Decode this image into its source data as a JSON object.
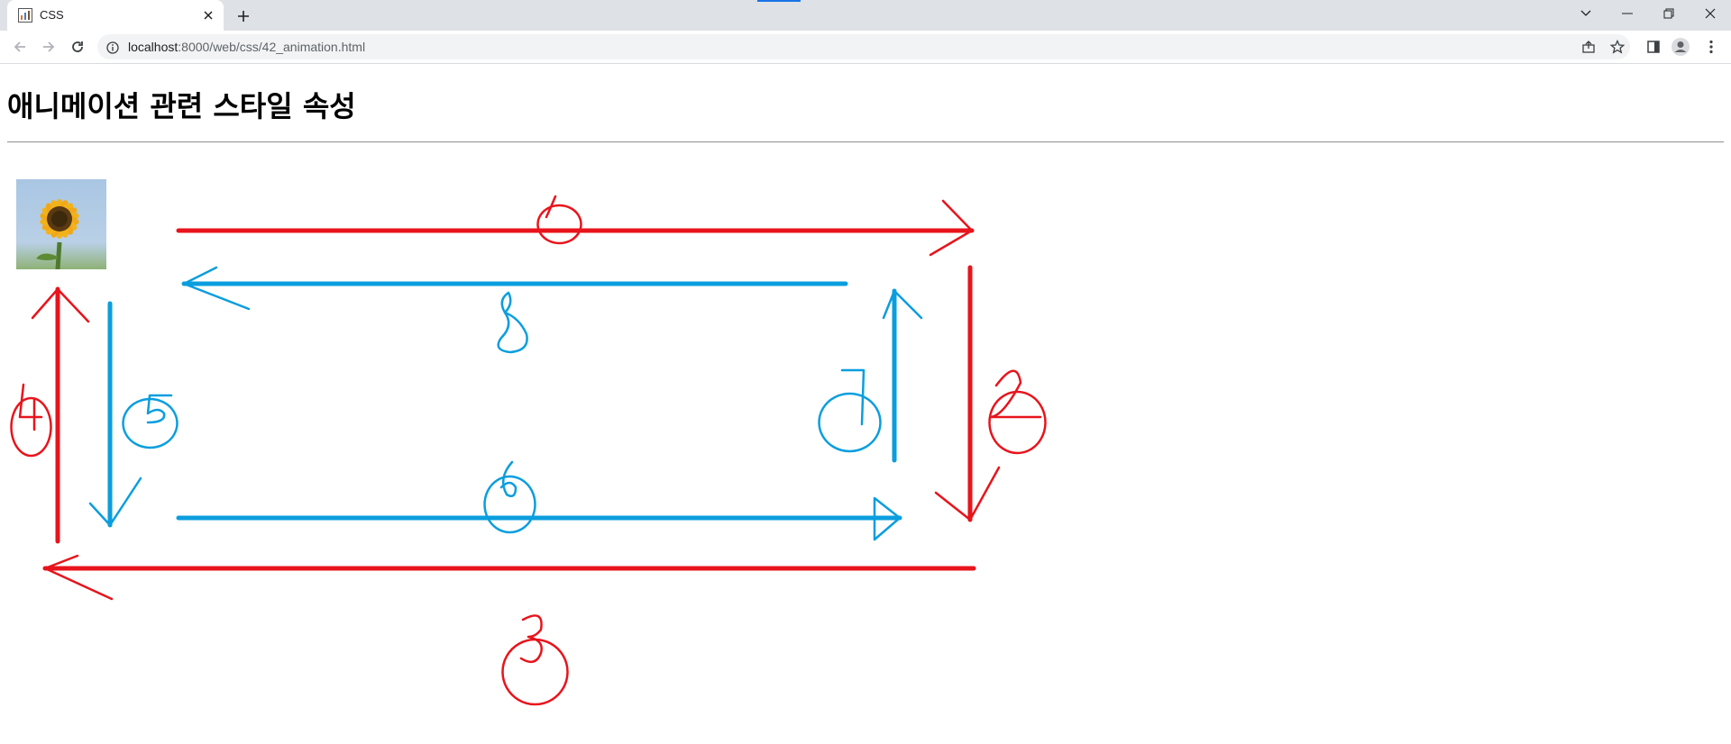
{
  "browser": {
    "tab": {
      "title": "CSS"
    },
    "address_bar": {
      "host": "localhost",
      "path": ":8000/web/css/42_animation.html"
    }
  },
  "page": {
    "heading": "애니메이션 관련 스타일 속성"
  },
  "annotations": {
    "red_color": "#e8141c",
    "blue_color": "#0a9ede",
    "marks": [
      "1",
      "2",
      "3",
      "4",
      "5",
      "6",
      "7",
      "8"
    ]
  },
  "icons": {
    "favicon": "chart-favicon-icon",
    "tab_close": "close-icon",
    "new_tab": "plus-icon",
    "back": "back-arrow-icon",
    "forward": "forward-arrow-icon",
    "reload": "reload-icon",
    "site_info": "info-icon",
    "share": "share-icon",
    "bookmark": "star-icon",
    "side_panel": "side-panel-icon",
    "profile": "profile-icon",
    "menu": "kebab-menu-icon",
    "tab_search": "chevron-down-icon",
    "minimize": "minimize-icon",
    "restore": "restore-icon",
    "close_window": "close-icon"
  }
}
